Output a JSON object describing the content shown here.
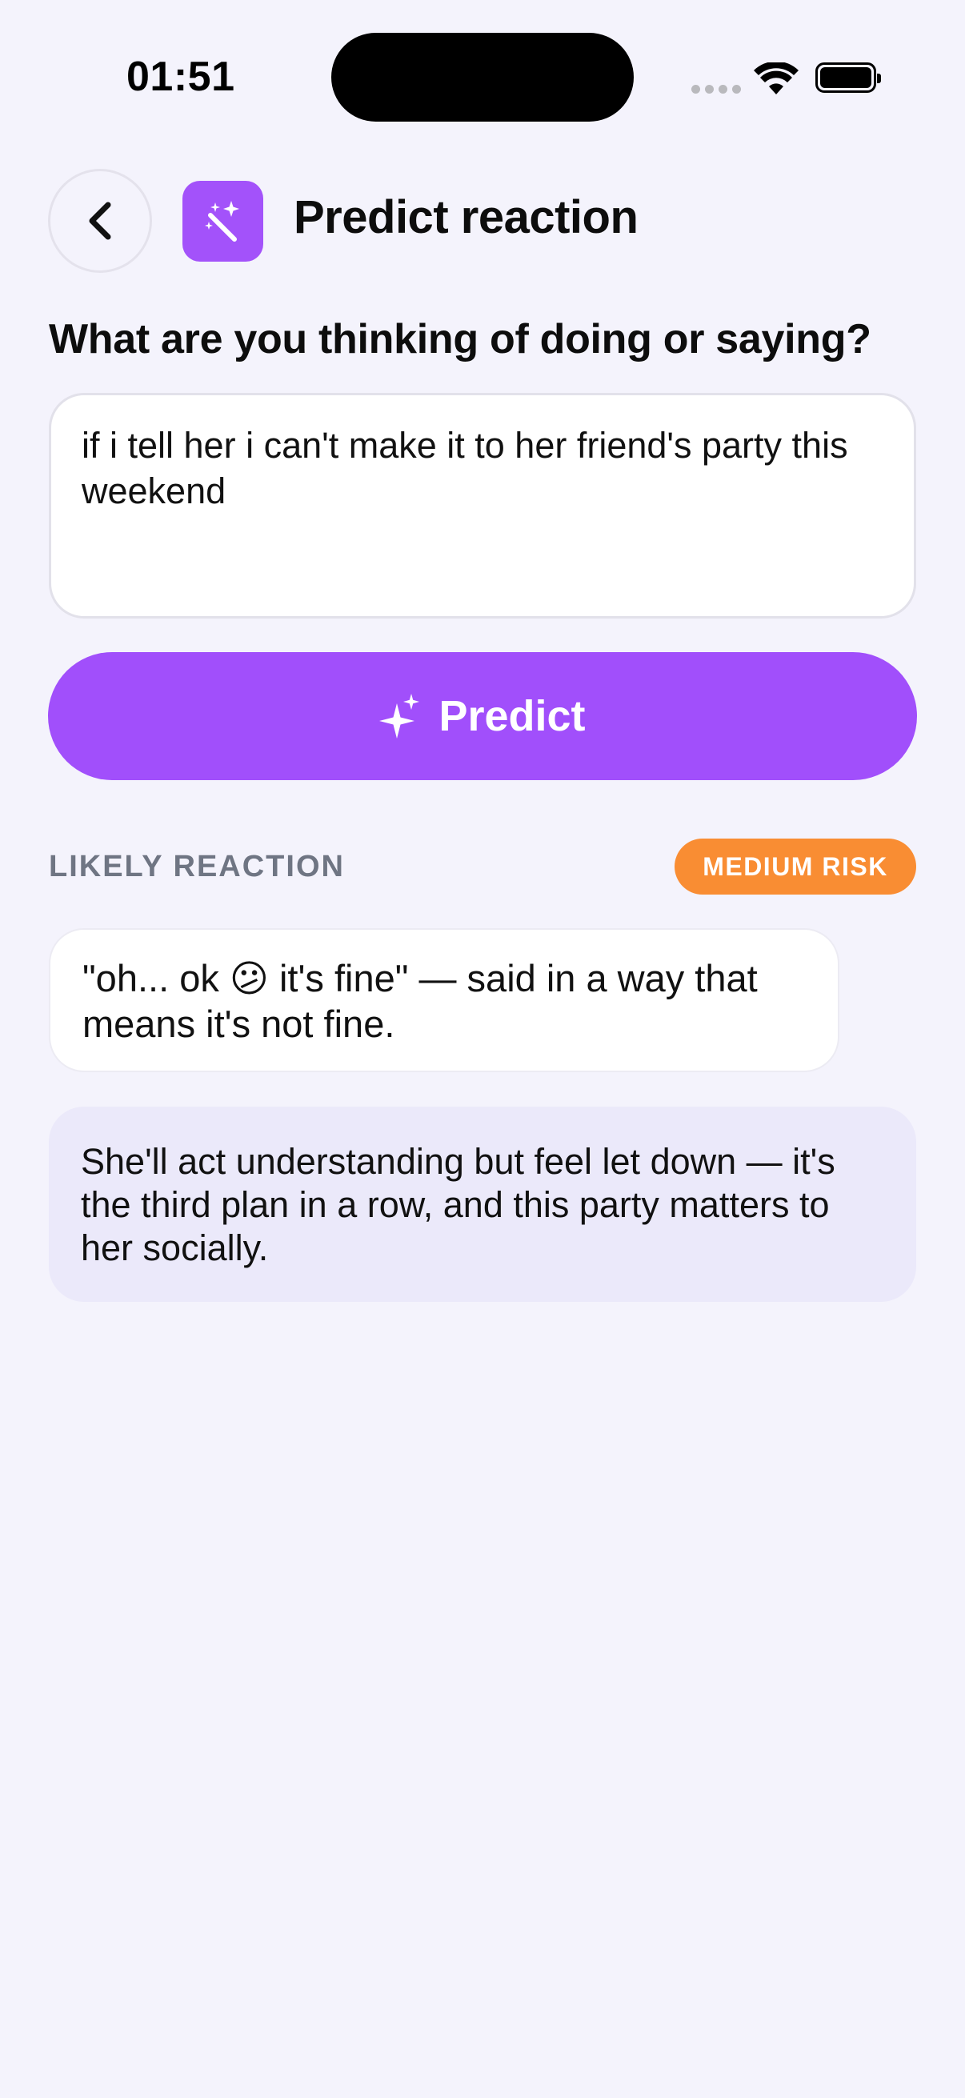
{
  "status_bar": {
    "time": "01:51"
  },
  "header": {
    "title": "Predict reaction",
    "back_icon": "chevron-left-icon",
    "app_icon": "magic-wand-icon",
    "accent_color": "#a352fa"
  },
  "prompt": {
    "label": "What are you thinking of doing or saying?",
    "input_value": "if i tell her i can't make it to her friend's party this weekend"
  },
  "predict_button": {
    "label": "Predict",
    "icon": "sparkles-icon"
  },
  "result": {
    "section_label": "LIKELY REACTION",
    "risk_badge": "MEDIUM RISK",
    "risk_color": "#f98d33",
    "quote": "\"oh... ok 😕 it's fine\" — said in a way that means it's not fine.",
    "explanation": "She'll act understanding but feel let down — it's the third plan in a row, and this party matters to her socially."
  }
}
